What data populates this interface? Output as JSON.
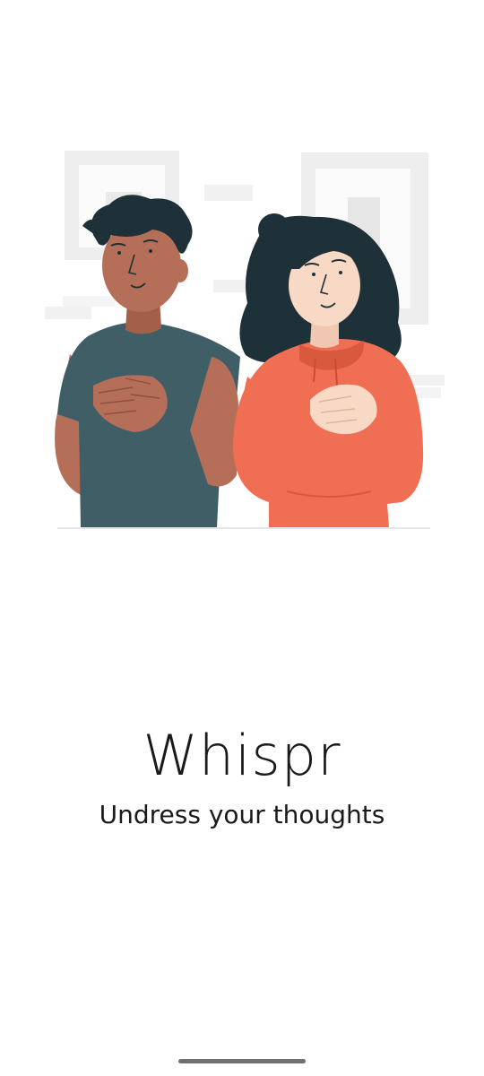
{
  "app": {
    "title": "Whispr",
    "tagline": "Undress your thoughts"
  },
  "illustration": {
    "subject": "two-people-hands-on-heart",
    "colors": {
      "man_shirt": "#3f5e66",
      "man_skin": "#b56f58",
      "woman_hoodie": "#ef6e54",
      "woman_skin": "#f8d9c5",
      "hair": "#1f3138",
      "background_frames": "#ebebeb"
    }
  },
  "system": {
    "home_indicator_color": "#707070"
  }
}
